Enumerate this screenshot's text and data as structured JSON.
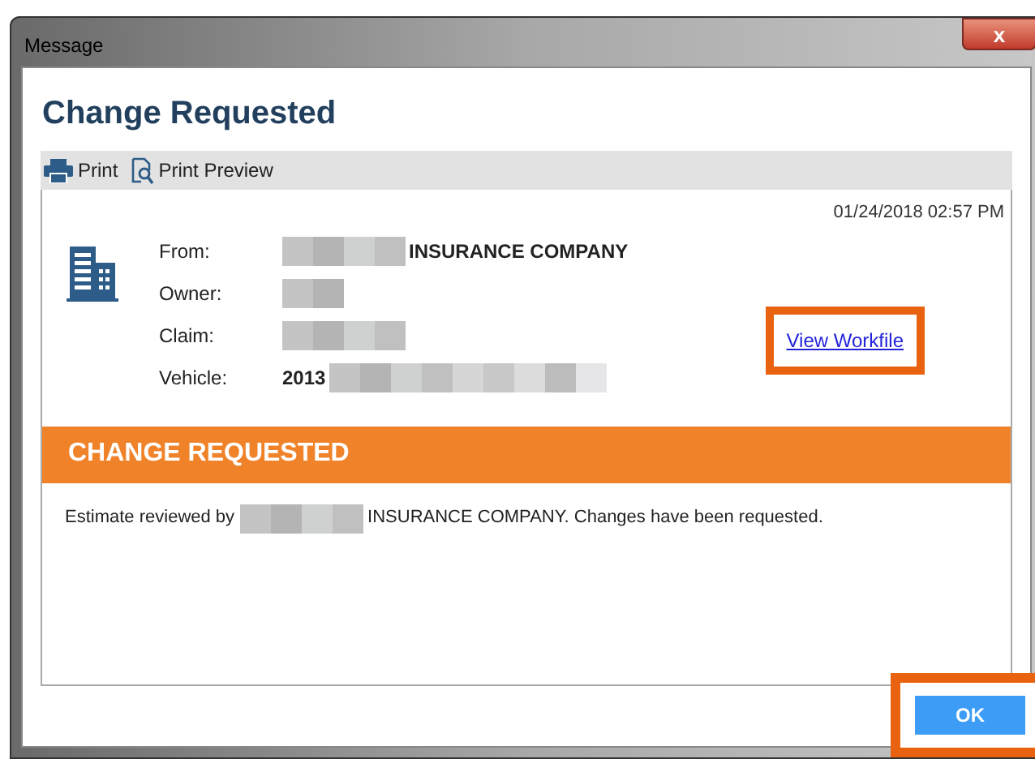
{
  "window": {
    "title": "Message",
    "close_label": "x"
  },
  "heading": "Change Requested",
  "toolbar": [
    {
      "kind": "print",
      "label": "Print"
    },
    {
      "kind": "preview",
      "label": "Print Preview"
    }
  ],
  "timestamp": "01/24/2018 02:57 PM",
  "fields": [
    {
      "label": "From:",
      "value": [
        {
          "kind": "redacted"
        },
        {
          "kind": "text",
          "text": "INSURANCE COMPANY"
        }
      ]
    },
    {
      "label": "Owner:",
      "value": [
        {
          "kind": "redactedshort"
        }
      ]
    },
    {
      "label": "Claim:",
      "value": [
        {
          "kind": "redacted"
        }
      ]
    },
    {
      "label": "Vehicle:",
      "value": [
        {
          "kind": "text",
          "text": "2013"
        },
        {
          "kind": "redactedlong"
        }
      ]
    }
  ],
  "link": {
    "label": "View Workfile",
    "highlighted": true
  },
  "banner": "CHANGE REQUESTED",
  "message": [
    {
      "kind": "text",
      "text": "Estimate reviewed by"
    },
    {
      "kind": "redacted"
    },
    {
      "kind": "text",
      "text": "INSURANCE COMPANY. Changes have been requested."
    }
  ],
  "ok": {
    "label": "OK",
    "highlighted": true
  }
}
